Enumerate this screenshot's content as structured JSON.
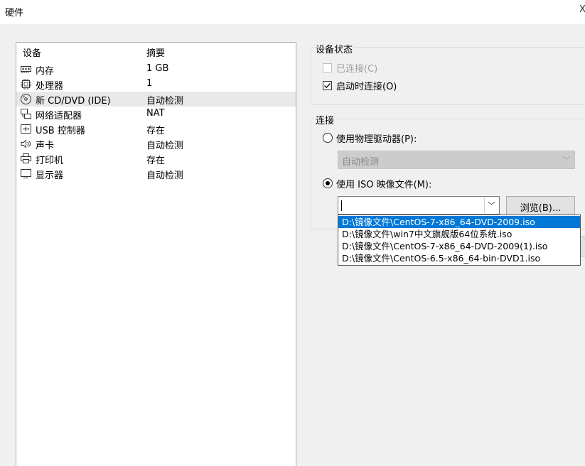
{
  "window": {
    "title": "硬件",
    "close_glyph": "X"
  },
  "device_list": {
    "columns": {
      "device": "设备",
      "summary": "摘要"
    },
    "rows": [
      {
        "icon": "memory-icon",
        "name": "内存",
        "summary": "1 GB"
      },
      {
        "icon": "processor-icon",
        "name": "处理器",
        "summary": "1"
      },
      {
        "icon": "cd-dvd-icon",
        "name": "新 CD/DVD (IDE)",
        "summary": "自动检测",
        "selected": true
      },
      {
        "icon": "network-adapter-icon",
        "name": "网络适配器",
        "summary": "NAT"
      },
      {
        "icon": "usb-icon",
        "name": "USB 控制器",
        "summary": "存在"
      },
      {
        "icon": "sound-icon",
        "name": "声卡",
        "summary": "自动检测"
      },
      {
        "icon": "printer-icon",
        "name": "打印机",
        "summary": "存在"
      },
      {
        "icon": "display-icon",
        "name": "显示器",
        "summary": "自动检测"
      }
    ]
  },
  "device_status": {
    "title": "设备状态",
    "connected": {
      "label": "已连接(C)",
      "checked": false,
      "enabled": false
    },
    "connect_at_power_on": {
      "label": "启动时连接(O)",
      "checked": true,
      "enabled": true
    }
  },
  "connection": {
    "title": "连接",
    "physical_drive": {
      "label": "使用物理驱动器(P):",
      "selected": false
    },
    "physical_drive_select": {
      "value": "自动检测",
      "enabled": false
    },
    "iso_image": {
      "label": "使用 ISO 映像文件(M):",
      "selected": true
    },
    "iso_input_value": "",
    "browse_label": "浏览(B)...",
    "iso_history": [
      "D:\\镜像文件\\CentOS-7-x86_64-DVD-2009.iso",
      "D:\\镜像文件\\win7中文旗舰版64位系统.iso",
      "D:\\镜像文件\\CentOS-7-x86_64-DVD-2009(1).iso",
      "D:\\镜像文件\\CentOS-6.5-x86_64-bin-DVD1.iso"
    ],
    "highlighted_history_index": 0
  },
  "colors": {
    "selection": "#0078d7",
    "row_selected": "#e8e8e8",
    "window_bg": "#f0f0f0"
  }
}
